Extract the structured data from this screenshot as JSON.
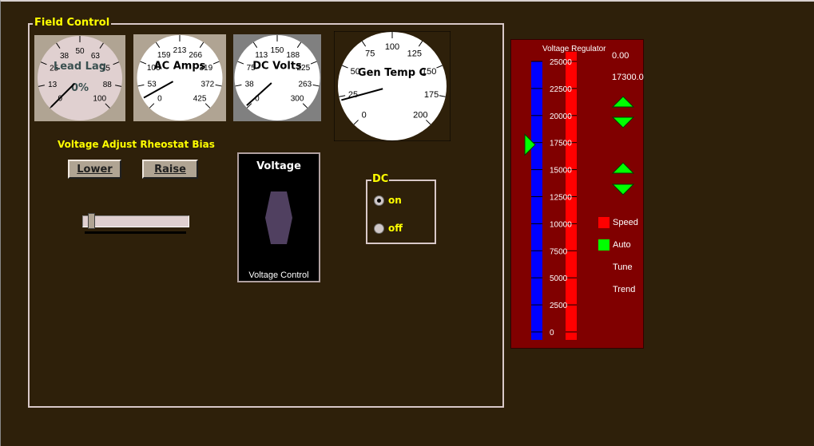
{
  "field_control": {
    "title": "Field Control"
  },
  "gauges": [
    {
      "label": "Lead Lag",
      "readout": "0%",
      "ticks": [
        "0",
        "13",
        "25",
        "38",
        "50",
        "63",
        "75",
        "88",
        "100"
      ],
      "min": 0,
      "max": 100,
      "value": 0,
      "face": "#e0d0d0",
      "bg": "#b0a493",
      "label_color": "#3a5050"
    },
    {
      "label": "AC Amps",
      "ticks": [
        "0",
        "53",
        "106",
        "159",
        "213",
        "266",
        "319",
        "372",
        "425"
      ],
      "min": 0,
      "max": 425,
      "value": 25,
      "face": "#ffffff",
      "bg": "#b0a493",
      "label_color": "#000000"
    },
    {
      "label": "DC Volts",
      "ticks": [
        "0",
        "38",
        "75",
        "113",
        "150",
        "188",
        "225",
        "263",
        "300"
      ],
      "min": 0,
      "max": 300,
      "value": 3,
      "face": "#ffffff",
      "bg": "#808080",
      "label_color": "#000000"
    },
    {
      "label": "Gen Temp C",
      "ticks": [
        "0",
        "25",
        "50",
        "75",
        "100",
        "125",
        "150",
        "175",
        "200"
      ],
      "min": 0,
      "max": 200,
      "value": 22,
      "face": "#ffffff",
      "bg": "#2e200a",
      "label_color": "#000000"
    }
  ],
  "rheostat": {
    "title": "Voltage Adjust Rheostat Bias",
    "lower_label": "Lower",
    "raise_label": "Raise",
    "slider_percent": 5
  },
  "voltage_control": {
    "title": "Voltage",
    "caption": "Voltage Control"
  },
  "dc": {
    "title": "DC",
    "options": [
      {
        "label": "on",
        "selected": true
      },
      {
        "label": "off",
        "selected": false
      }
    ]
  },
  "voltage_regulator": {
    "title": "Voltage Regulator",
    "value_top": "0.00",
    "setpoint": "17300.0",
    "setpoint_value": 17300,
    "scale": [
      "25000",
      "22500",
      "20000",
      "17500",
      "15000",
      "12500",
      "10000",
      "7500",
      "5000",
      "2500",
      "0"
    ],
    "scale_max": 25000,
    "legend": [
      {
        "label": "Speed",
        "color": "#ff0000"
      },
      {
        "label": "Auto",
        "color": "#00ff00"
      },
      {
        "label": "Tune"
      },
      {
        "label": "Trend"
      }
    ],
    "colors": {
      "panel": "#800000",
      "bar_left": "#0000ff",
      "bar_right": "#ff0000",
      "arrows": "#00ff00"
    }
  }
}
